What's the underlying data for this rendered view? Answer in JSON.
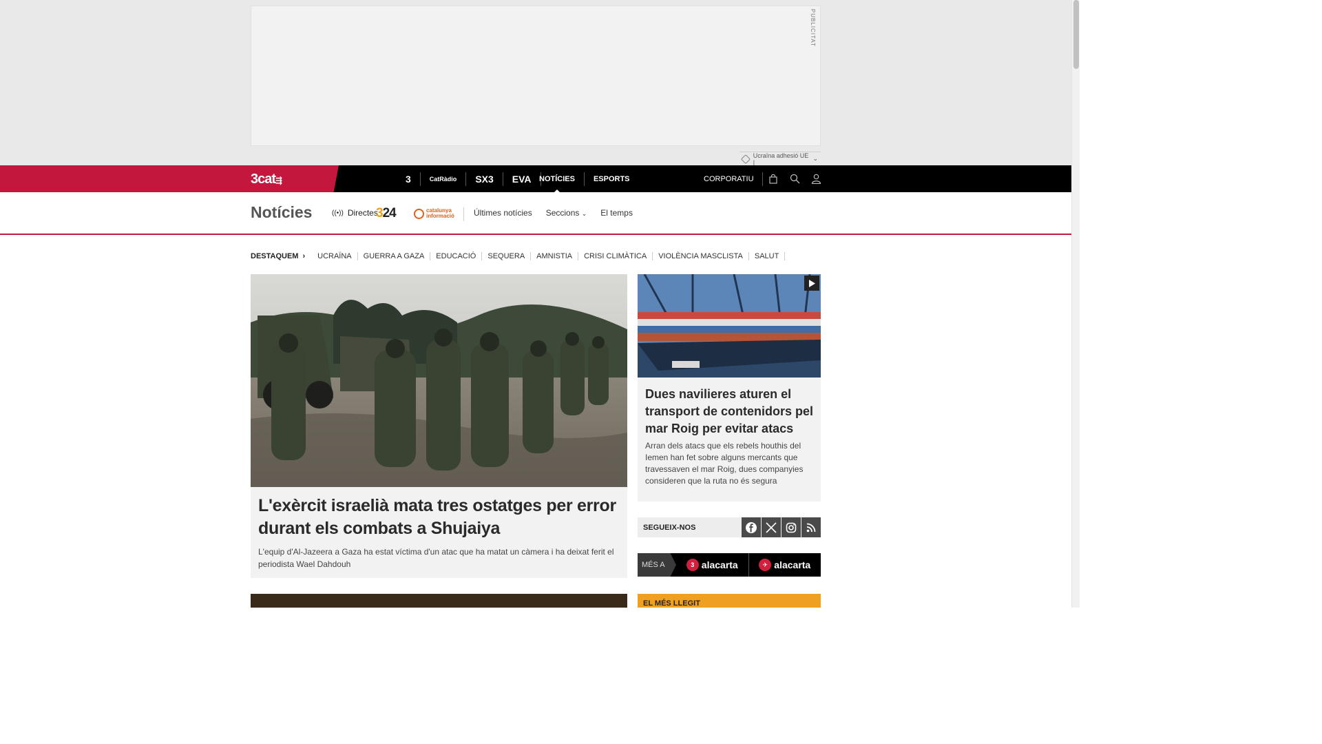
{
  "ad": {
    "label": "PUBLICITAT"
  },
  "topic_tag": {
    "label": "Ucraïna adhesió UE |"
  },
  "navbar": {
    "logo": "3cat",
    "channels": [
      "3",
      "CatRàdio",
      "SX3",
      "EVA"
    ],
    "links": [
      "NOTÍCIES",
      "ESPORTS"
    ],
    "active_link": "NOTÍCIES",
    "corporate": "CORPORATIU",
    "icons": [
      "shop-icon",
      "search-icon",
      "user-icon"
    ]
  },
  "section": {
    "title": "Notícies",
    "directes": "Directes",
    "logo_324": {
      "prefix": "3",
      "suffix": "24"
    },
    "logo_cati": [
      "catalunya",
      "informació"
    ],
    "links": [
      "Últimes notícies",
      "Seccions",
      "El temps"
    ]
  },
  "tags": {
    "lead": "DESTAQUEM",
    "items": [
      "UCRAÏNA",
      "GUERRA A GAZA",
      "EDUCACIÓ",
      "SEQUERA",
      "AMNISTIA",
      "CRISI CLIMÀTICA",
      "VIOLÈNCIA MASCLISTA",
      "SALUT"
    ]
  },
  "main_article": {
    "title": "L'exèrcit israelià mata tres ostatges per error durant els combats a Shujaiya",
    "summary": "L'equip d'Al-Jazeera a Gaza ha estat víctima d'un atac que ha matat un càmera i ha deixat ferit el periodista Wael Dahdouh"
  },
  "side_article": {
    "title": "Dues navilieres aturen el transport de contenidors pel mar Roig per evitar atacs",
    "summary": "Arran dels atacs que els rebels houthis del Iemen han fet sobre alguns mercants que travessaven el mar Roig, dues companyies consideren que la ruta no és segura"
  },
  "follow": {
    "label": "SEGUEIX-NOS",
    "networks": [
      "facebook-icon",
      "x-icon",
      "instagram-icon",
      "rss-icon"
    ]
  },
  "alacarta": {
    "lead": "MÉS A",
    "items": [
      {
        "badge": "3",
        "label": "alacarta"
      },
      {
        "badge": "✈",
        "label": "alacarta"
      }
    ]
  },
  "most_read": {
    "label": "EL MÉS LLEGIT"
  }
}
